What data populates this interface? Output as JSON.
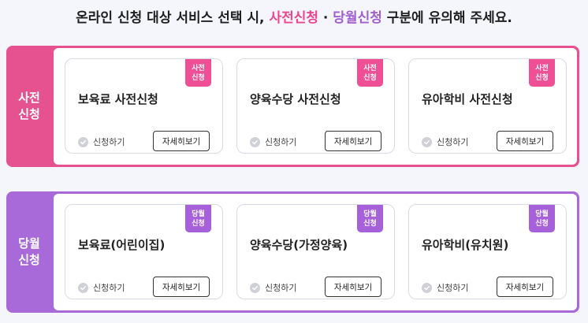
{
  "notice": {
    "prefix": "온라인 신청 대상 서비스 선택 시, ",
    "advance_term": "사전신청",
    "separator": " · ",
    "monthly_term": "당월신청",
    "suffix": " 구분에 유의해 주세요."
  },
  "sections": {
    "advance": {
      "label_line1": "사전",
      "label_line2": "신청",
      "color": "#e65290",
      "cards": [
        {
          "title": "보육료 사전신청",
          "badge_line1": "사전",
          "badge_line2": "신청",
          "apply_label": "신청하기",
          "detail_label": "자세히보기"
        },
        {
          "title": "양육수당 사전신청",
          "badge_line1": "사전",
          "badge_line2": "신청",
          "apply_label": "신청하기",
          "detail_label": "자세히보기"
        },
        {
          "title": "유아학비 사전신청",
          "badge_line1": "사전",
          "badge_line2": "신청",
          "apply_label": "신청하기",
          "detail_label": "자세히보기"
        }
      ]
    },
    "monthly": {
      "label_line1": "당월",
      "label_line2": "신청",
      "color": "#a76ad8",
      "cards": [
        {
          "title": "보육료(어린이집)",
          "badge_line1": "당월",
          "badge_line2": "신청",
          "apply_label": "신청하기",
          "detail_label": "자세히보기"
        },
        {
          "title": "양육수당(가정양육)",
          "badge_line1": "당월",
          "badge_line2": "신청",
          "apply_label": "신청하기",
          "detail_label": "자세히보기"
        },
        {
          "title": "유아학비(유치원)",
          "badge_line1": "당월",
          "badge_line2": "신청",
          "apply_label": "신청하기",
          "detail_label": "자세히보기"
        }
      ]
    }
  }
}
